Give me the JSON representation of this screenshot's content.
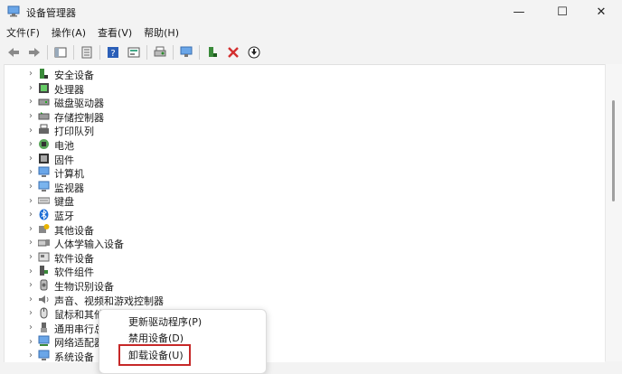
{
  "window": {
    "title": "设备管理器",
    "minimize": "—",
    "maximize": "☐",
    "close": "✕"
  },
  "menu": [
    "文件(F)",
    "操作(A)",
    "查看(V)",
    "帮助(H)"
  ],
  "toolbar": {
    "icons": [
      "back-arrow-icon",
      "forward-arrow-icon",
      "show-hide-pane-icon",
      "properties-icon",
      "help-icon",
      "view-icon",
      "print-icon",
      "monitor-scan-icon",
      "add-driver-icon",
      "uninstall-x-icon",
      "update-driver-down-icon"
    ]
  },
  "tree": {
    "items": [
      {
        "label": "安全设备",
        "icon": "security-device-icon"
      },
      {
        "label": "处理器",
        "icon": "processor-icon"
      },
      {
        "label": "磁盘驱动器",
        "icon": "disk-drive-icon"
      },
      {
        "label": "存储控制器",
        "icon": "storage-controller-icon"
      },
      {
        "label": "打印队列",
        "icon": "printer-icon"
      },
      {
        "label": "电池",
        "icon": "battery-icon"
      },
      {
        "label": "固件",
        "icon": "firmware-icon"
      },
      {
        "label": "计算机",
        "icon": "computer-icon"
      },
      {
        "label": "监视器",
        "icon": "monitor-icon"
      },
      {
        "label": "键盘",
        "icon": "keyboard-icon"
      },
      {
        "label": "蓝牙",
        "icon": "bluetooth-icon"
      },
      {
        "label": "其他设备",
        "icon": "other-device-icon"
      },
      {
        "label": "人体学输入设备",
        "icon": "hid-icon"
      },
      {
        "label": "软件设备",
        "icon": "software-device-icon"
      },
      {
        "label": "软件组件",
        "icon": "software-component-icon"
      },
      {
        "label": "生物识别设备",
        "icon": "biometric-icon"
      },
      {
        "label": "声音、视频和游戏控制器",
        "icon": "sound-icon"
      },
      {
        "label": "鼠标和其他",
        "icon": "mouse-icon"
      },
      {
        "label": "通用串行总",
        "icon": "usb-icon"
      },
      {
        "label": "网络适配器",
        "icon": "network-adapter-icon"
      },
      {
        "label": "系统设备",
        "icon": "system-device-icon"
      }
    ]
  },
  "context_menu": {
    "items": [
      "更新驱动程序(P)",
      "禁用设备(D)",
      "卸载设备(U)"
    ],
    "highlighted": "卸载设备(U)"
  },
  "colors": {
    "highlight_border": "#c62828",
    "accent_blue": "#2b7bd6",
    "uninstall_red": "#d32f2f"
  }
}
